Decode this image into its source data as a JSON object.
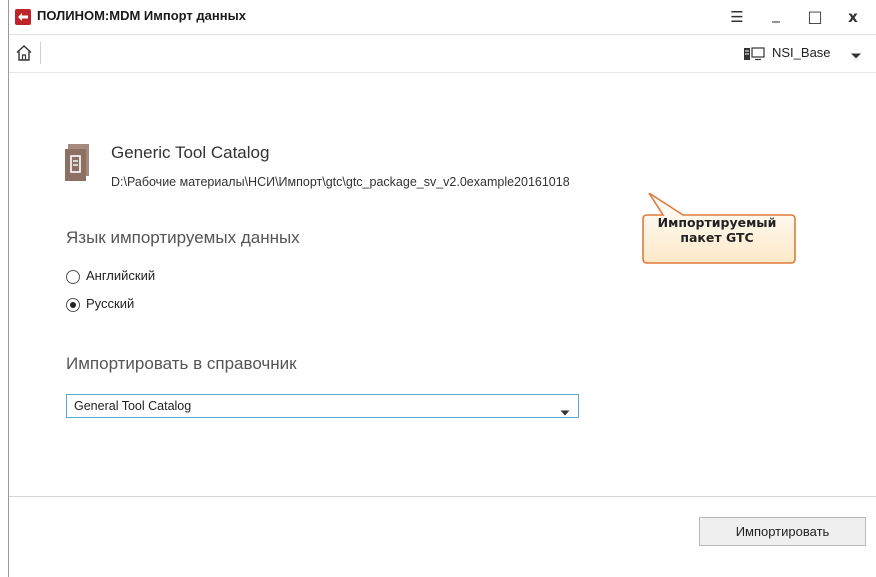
{
  "window": {
    "title": "ПОЛИНОМ:MDM Импорт данных",
    "menu_glyph": "☰",
    "minimize_glyph": "_",
    "maximize_glyph": "□",
    "close_glyph": "x"
  },
  "toolbar": {
    "database_name": "NSI_Base"
  },
  "catalog": {
    "name": "Generic Tool Catalog",
    "path": "D:\\Рабочие материалы\\НСИ\\Импорт\\gtc\\gtc_package_sv_v2.0example20161018"
  },
  "callout": {
    "line1": "Импортируемый",
    "line2": "пакет GTC"
  },
  "language_section": {
    "heading": "Язык импортируемых данных",
    "options": [
      {
        "label": "Английский",
        "selected": false
      },
      {
        "label": "Русский",
        "selected": true
      }
    ]
  },
  "target_section": {
    "heading": "Импортировать в справочник",
    "selected_value": "General Tool Catalog"
  },
  "footer": {
    "import_button": "Импортировать"
  },
  "colors": {
    "brand": "#c0242b",
    "callout_fill": "#fff8e6",
    "callout_border": "#e07a3a",
    "select_border": "#5aaed6",
    "catalog_icon": "#8b7063"
  }
}
